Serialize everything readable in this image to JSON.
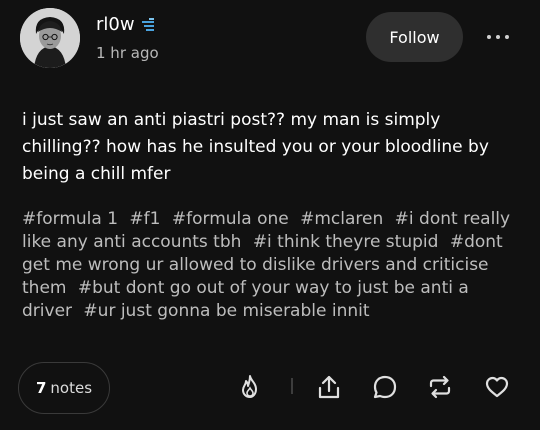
{
  "post": {
    "username": "rl0w",
    "timestamp": "1 hr ago",
    "follow_label": "Follow",
    "body": "i just saw an anti piastri post?? my man is simply chilling?? how has he insulted you or your bloodline by being a chill mfer",
    "tags": [
      "#formula 1",
      "#f1",
      "#formula one",
      "#mclaren",
      "#i dont really like any anti accounts tbh",
      "#i think theyre stupid",
      "#dont get me wrong ur allowed to dislike drivers and criticise them",
      "#but dont go out of your way to just be anti a driver",
      "#ur just gonna be miserable innit"
    ]
  },
  "footer": {
    "notes_count": "7",
    "notes_label": "notes"
  },
  "icons": {
    "verified": "verified-badge-icon",
    "blaze": "flame-icon",
    "share": "share-icon",
    "reply": "speech-bubble-icon",
    "reblog": "reblog-arrows-icon",
    "like": "heart-icon"
  },
  "colors": {
    "background": "#111111",
    "text": "#ffffff",
    "secondary_text": "#bdbdbd",
    "button_bg": "#2f2f2f",
    "verified_badge": "#4aa3df"
  }
}
